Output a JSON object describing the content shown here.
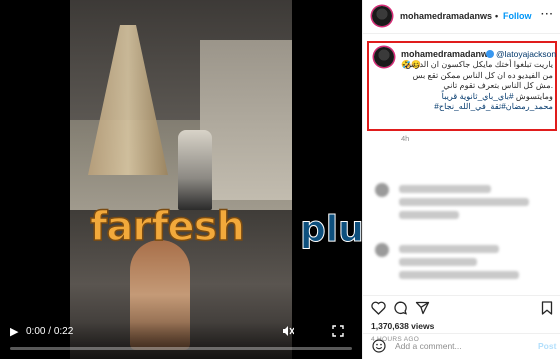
{
  "video": {
    "time_current": "0:00",
    "time_total": "0:22",
    "progress_fraction": 0,
    "watermark_main": "farfesh",
    "watermark_suffix": "plus.com"
  },
  "header": {
    "username": "mohamedramadanws",
    "separator": "•",
    "follow_label": "Follow",
    "more_label": "···"
  },
  "caption": {
    "username": "mohamedramadanws",
    "mention": "@latoyajackson",
    "emoji": "🤣😊",
    "line1": "ياريت تبلغوا أختك مايكل جاكسون ان الدرس",
    "line2": "من الفيديو ده ان كل الناس ممكن تقع بس",
    "line3": ".مش كل الناس بتعرف تقوم تاني",
    "line4_text": "ومايتسوش ",
    "line4_tag": "#باي_باي_ثانوية قريباً",
    "line5_tag": "#ثقة_في_الله_نجاح#",
    "line5_text": " محمد_رمضان",
    "time_ago": "4h"
  },
  "stats": {
    "likes": "1,370,638 views",
    "date": "4 HOURS AGO"
  },
  "comment_box": {
    "placeholder": "Add a comment...",
    "post_label": "Post"
  },
  "colors": {
    "accent": "#0095f6",
    "highlight_border": "#e01d1d",
    "link": "#00376b"
  },
  "icons": {
    "play": "play-icon",
    "mute": "mute-icon",
    "fullscreen": "fullscreen-icon",
    "heart": "heart-icon",
    "comment": "comment-icon",
    "share": "share-icon",
    "bookmark": "bookmark-icon",
    "emoji": "emoji-icon",
    "verified": "verified-badge-icon"
  }
}
